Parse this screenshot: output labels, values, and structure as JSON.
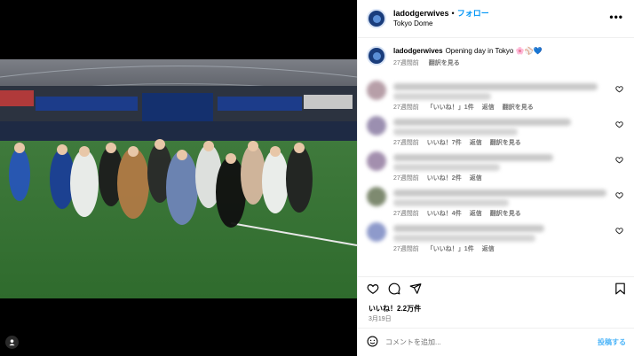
{
  "header": {
    "username": "ladodgerwives",
    "separator": "•",
    "follow_label": "フォロー",
    "location": "Tokyo Dome",
    "more_icon": "more-horizontal-icon"
  },
  "caption": {
    "username": "ladodgerwives",
    "text": "Opening day in Tokyo 🌸⚾💙",
    "time": "27週間前",
    "translate": "翻訳を見る"
  },
  "comments": [
    {
      "time": "27週間前",
      "likes": "「いいね！」1件",
      "reply": "返信",
      "translate": "翻訳を見る",
      "avatar_color": "#b79fa8"
    },
    {
      "time": "27週間前",
      "likes": "いいね！7件",
      "reply": "返信",
      "translate": "翻訳を見る",
      "avatar_color": "#9b8fb0"
    },
    {
      "time": "27週間前",
      "likes": "いいね！2件",
      "reply": "返信",
      "translate": "",
      "avatar_color": "#a38fae"
    },
    {
      "time": "27週間前",
      "likes": "いいね！4件",
      "reply": "返信",
      "translate": "翻訳を見る",
      "avatar_color": "#7e8a70"
    },
    {
      "time": "27週間前",
      "likes": "「いいね！」1件",
      "reply": "返信",
      "translate": "",
      "avatar_color": "#8e9acb"
    }
  ],
  "actions": {
    "like_icon": "heart-icon",
    "comment_icon": "comment-icon",
    "share_icon": "share-icon",
    "save_icon": "bookmark-icon"
  },
  "likes_count": "いいね！2.2万件",
  "post_date": "3月19日",
  "add_comment": {
    "placeholder": "コメントを追加...",
    "post_label": "投稿する",
    "emoji_icon": "emoji-icon"
  },
  "colors": {
    "accent": "#0095f6",
    "muted": "#737373"
  }
}
